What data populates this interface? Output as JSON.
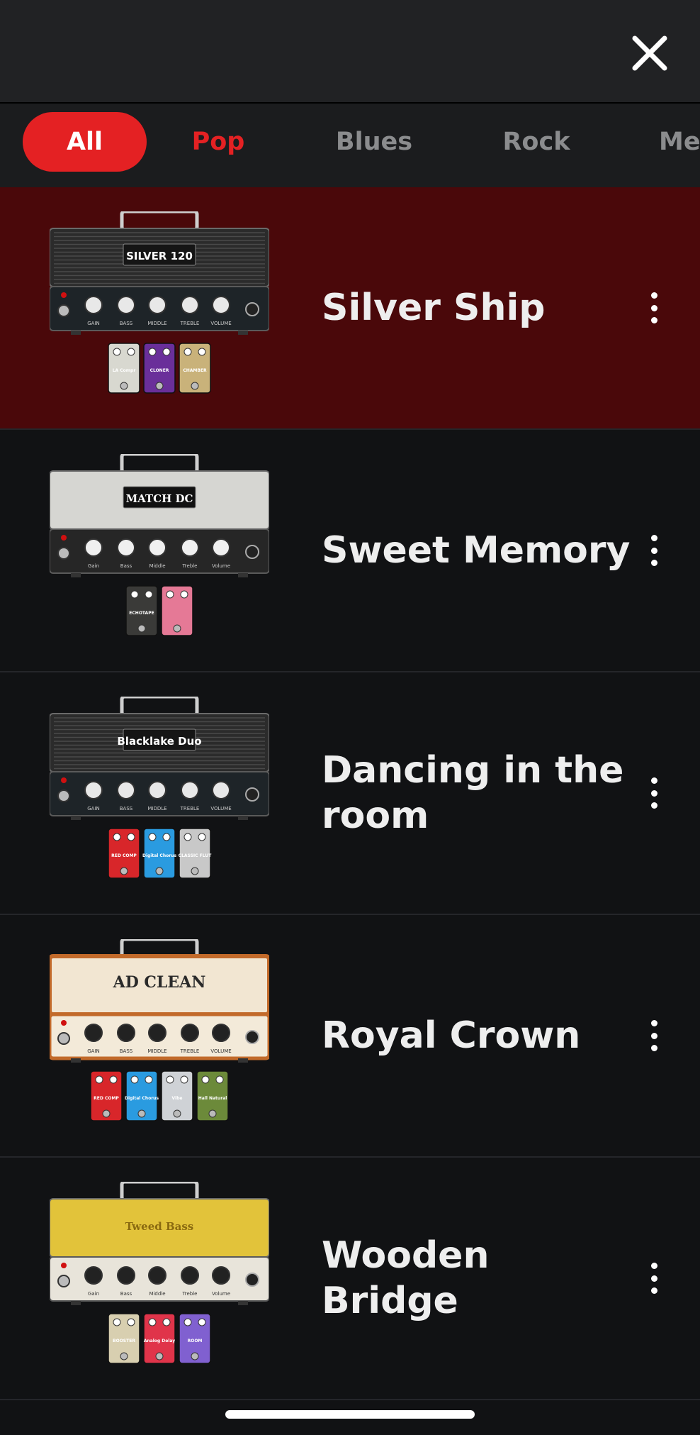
{
  "header": {
    "close_icon": "close-icon"
  },
  "tabs": [
    {
      "label": "All",
      "state": "active"
    },
    {
      "label": "Pop",
      "state": "highlight"
    },
    {
      "label": "Blues",
      "state": "normal"
    },
    {
      "label": "Rock",
      "state": "normal"
    },
    {
      "label": "Me",
      "state": "normal"
    }
  ],
  "presets": [
    {
      "title": "Silver Ship",
      "amp_label": "SILVER 120",
      "amp_style": "grille",
      "knob_labels": [
        "GAIN",
        "BASS",
        "MIDDLE",
        "TREBLE",
        "VOLUME"
      ],
      "pedals": [
        {
          "color": "#d8d8d0",
          "label": "LA Compr"
        },
        {
          "color": "#6a2f9a",
          "label": "CLONER"
        },
        {
          "color": "#c9b27a",
          "label": "CHAMBER"
        }
      ]
    },
    {
      "title": "Sweet Memory",
      "amp_label": "MATCH DC",
      "amp_style": "silver",
      "knob_labels": [
        "Gain",
        "Bass",
        "Middle",
        "Treble",
        "Volume"
      ],
      "pedals": [
        {
          "color": "#3a3a38",
          "label": "ECHOTAPE"
        },
        {
          "color": "#e57996",
          "label": ""
        }
      ]
    },
    {
      "title": "Dancing in the room",
      "amp_label": "Blacklake Duo",
      "amp_style": "grille",
      "knob_labels": [
        "GAIN",
        "BASS",
        "MIDDLE",
        "TREBLE",
        "VOLUME"
      ],
      "pedals": [
        {
          "color": "#d8262a",
          "label": "RED COMP"
        },
        {
          "color": "#2a9be0",
          "label": "Digital Chorus"
        },
        {
          "color": "#c8c8c8",
          "label": "CLASSIC FLUT"
        }
      ]
    },
    {
      "title": "Royal Crown",
      "amp_label": "AD CLEAN",
      "amp_style": "cream",
      "knob_labels": [
        "GAIN",
        "BASS",
        "MIDDLE",
        "TREBLE",
        "VOLUME"
      ],
      "pedals": [
        {
          "color": "#d8262a",
          "label": "RED COMP"
        },
        {
          "color": "#2a9be0",
          "label": "Digital Chorus"
        },
        {
          "color": "#cfd2d6",
          "label": "Vibe"
        },
        {
          "color": "#6c8a3a",
          "label": "Hall Natural"
        }
      ]
    },
    {
      "title": "Wooden Bridge",
      "amp_label": "Tweed Bass",
      "amp_style": "yellow",
      "knob_labels": [
        "Gain",
        "Bass",
        "Middle",
        "Treble",
        "Volume"
      ],
      "pedals": [
        {
          "color": "#d8cfb0",
          "label": "BOOSTER"
        },
        {
          "color": "#e0344a",
          "label": "Analog Delay"
        },
        {
          "color": "#8060d0",
          "label": "ROOM"
        }
      ]
    }
  ]
}
